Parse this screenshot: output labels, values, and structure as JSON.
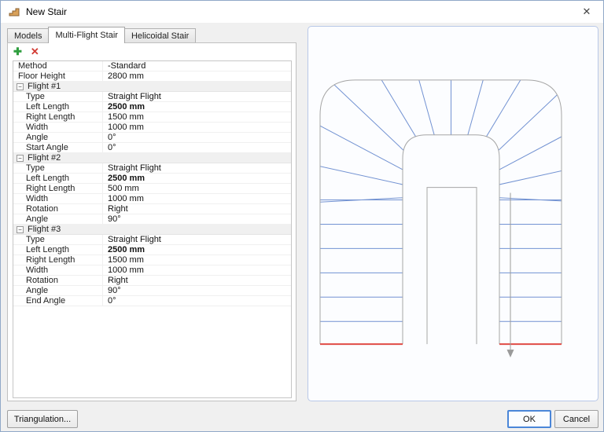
{
  "window": {
    "title": "New Stair",
    "close_glyph": "✕"
  },
  "tabs": [
    {
      "label": "Models",
      "active": false
    },
    {
      "label": "Multi-Flight Stair",
      "active": true
    },
    {
      "label": "Helicoidal Stair",
      "active": false
    }
  ],
  "toolbar": {
    "add_glyph": "✚",
    "delete_glyph": "✕"
  },
  "grid": {
    "collapse_glyph": "−",
    "rows": [
      {
        "type": "property",
        "label": "Method",
        "value": "-Standard"
      },
      {
        "type": "property",
        "label": "Floor Height",
        "value": "2800 mm"
      },
      {
        "type": "group",
        "label": "Flight #1"
      },
      {
        "type": "property",
        "label": "Type",
        "value": "Straight Flight",
        "indent": true
      },
      {
        "type": "property",
        "label": "Left Length",
        "value": "2500 mm",
        "bold": true,
        "indent": true
      },
      {
        "type": "property",
        "label": "Right Length",
        "value": "1500 mm",
        "indent": true
      },
      {
        "type": "property",
        "label": "Width",
        "value": "1000 mm",
        "indent": true
      },
      {
        "type": "property",
        "label": "Angle",
        "value": "0°",
        "indent": true
      },
      {
        "type": "property",
        "label": "Start Angle",
        "value": "0°",
        "indent": true
      },
      {
        "type": "group",
        "label": "Flight #2"
      },
      {
        "type": "property",
        "label": "Type",
        "value": "Straight Flight",
        "indent": true
      },
      {
        "type": "property",
        "label": "Left Length",
        "value": "2500 mm",
        "bold": true,
        "indent": true
      },
      {
        "type": "property",
        "label": "Right Length",
        "value": "500 mm",
        "indent": true
      },
      {
        "type": "property",
        "label": "Width",
        "value": "1000 mm",
        "indent": true
      },
      {
        "type": "property",
        "label": "Rotation",
        "value": "Right",
        "indent": true
      },
      {
        "type": "property",
        "label": "Angle",
        "value": "90°",
        "indent": true
      },
      {
        "type": "group",
        "label": "Flight #3"
      },
      {
        "type": "property",
        "label": "Type",
        "value": "Straight Flight",
        "indent": true
      },
      {
        "type": "property",
        "label": "Left Length",
        "value": "2500 mm",
        "bold": true,
        "indent": true
      },
      {
        "type": "property",
        "label": "Right Length",
        "value": "1500 mm",
        "indent": true
      },
      {
        "type": "property",
        "label": "Width",
        "value": "1000 mm",
        "indent": true
      },
      {
        "type": "property",
        "label": "Rotation",
        "value": "Right",
        "indent": true
      },
      {
        "type": "property",
        "label": "Angle",
        "value": "90°",
        "indent": true
      },
      {
        "type": "property",
        "label": "End Angle",
        "value": "0°",
        "indent": true
      }
    ]
  },
  "preview": {
    "colors": {
      "tread": "#7292d2",
      "outline": "#a6a6a6",
      "flight_end_line": "#e04b45",
      "walk_arrow": "#9a9a9a",
      "panel_bg": "#fcfdff",
      "panel_border": "#b9c8e8"
    }
  },
  "footer": {
    "triangulation_label": "Triangulation...",
    "ok_label": "OK",
    "cancel_label": "Cancel"
  }
}
